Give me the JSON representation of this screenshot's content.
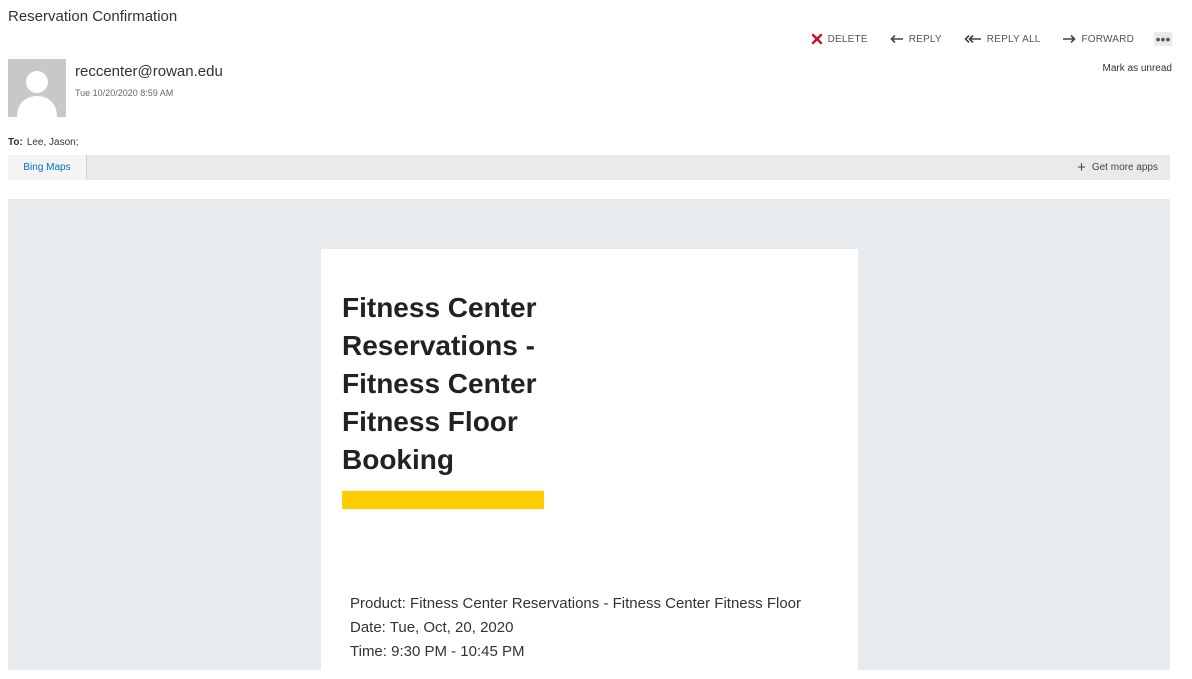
{
  "email": {
    "subject": "Reservation Confirmation",
    "sender": "reccenter@rowan.edu",
    "date": "Tue 10/20/2020 8:59 AM",
    "to_label": "To:",
    "to_value": "Lee, Jason;",
    "mark_unread": "Mark as unread"
  },
  "toolbar": {
    "delete": "DELETE",
    "reply": "REPLY",
    "reply_all": "REPLY ALL",
    "forward": "FORWARD",
    "more": "•••",
    "delete_color": "#c8102e"
  },
  "appbar": {
    "tab": "Bing Maps",
    "more_apps": "Get more apps"
  },
  "message": {
    "title": "Fitness Center Reservations - Fitness Center Fitness Floor Booking",
    "highlight_color": "#ffcc00",
    "product": "Product: Fitness Center Reservations - Fitness Center Fitness Floor",
    "date": "Date: Tue, Oct, 20, 2020",
    "time": "Time: 9:30 PM - 10:45 PM"
  }
}
